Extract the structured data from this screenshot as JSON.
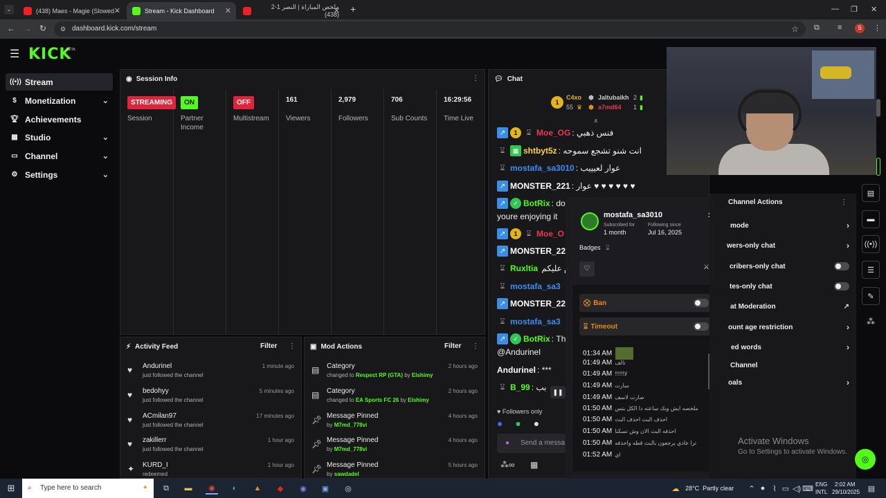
{
  "browser": {
    "tabs": [
      {
        "title": "(438) Maes - Magie (Slowed -"
      },
      {
        "title": "Stream - Kick Dashboard"
      },
      {
        "title": "ملخص المباراة | النصر 1-2 (438)"
      }
    ],
    "url": "dashboard.kick.com/stream",
    "profile_initial": "S"
  },
  "app": {
    "logo": "KICK",
    "logo_tag": "BETA",
    "brand_color": "#53fc18"
  },
  "sidebar": {
    "items": [
      {
        "label": "Stream",
        "icon": "stream-icon"
      },
      {
        "label": "Monetization",
        "icon": "dollar-icon"
      },
      {
        "label": "Achievements",
        "icon": "trophy-icon"
      },
      {
        "label": "Studio",
        "icon": "studio-icon"
      },
      {
        "label": "Channel",
        "icon": "channel-icon"
      },
      {
        "label": "Settings",
        "icon": "gear-icon"
      }
    ]
  },
  "session": {
    "title": "Session Info",
    "stats": [
      {
        "value": "STREAMING",
        "label": "Session"
      },
      {
        "value": "ON",
        "label": "Partner Income"
      },
      {
        "value": "OFF",
        "label": "Multistream"
      },
      {
        "value": "161",
        "label": "Viewers"
      },
      {
        "value": "2,979",
        "label": "Followers"
      },
      {
        "value": "706",
        "label": "Sub Counts"
      },
      {
        "value": "16:29:56",
        "label": "Time Live"
      }
    ]
  },
  "activity": {
    "title": "Activity Feed",
    "filter": "Filter",
    "items": [
      {
        "name": "Andurinel",
        "action": "just followed the channel",
        "time": "1 minute ago"
      },
      {
        "name": "bedohyy",
        "action": "just followed the channel",
        "time": "5 minutes ago"
      },
      {
        "name": "ACmilan97",
        "action": "just followed the channel",
        "time": "17 minutes ago"
      },
      {
        "name": "zakillerr",
        "action": "just followed the channel",
        "time": "1 hour ago"
      },
      {
        "name": "KURD_I",
        "action": "redeemed",
        "time": "1 hour ago"
      }
    ]
  },
  "mod": {
    "title": "Mod Actions",
    "filter": "Filter",
    "items": [
      {
        "title": "Category",
        "pre": "changed to",
        "target": "Respect RP (GTA)",
        "by": "by",
        "user": "Elshimy",
        "time": "2 hours ago"
      },
      {
        "title": "Category",
        "pre": "changed to",
        "target": "EA Sports FC 26",
        "by": "by",
        "user": "Elshimy",
        "time": "2 hours ago"
      },
      {
        "title": "Message Pinned",
        "pre": "by",
        "target": "",
        "by": "",
        "user": "M7md_778vi",
        "time": "4 hours ago"
      },
      {
        "title": "Message Pinned",
        "pre": "by",
        "target": "",
        "by": "",
        "user": "M7md_778vi",
        "time": "4 hours ago"
      },
      {
        "title": "Message Pinned",
        "pre": "by",
        "target": "",
        "by": "",
        "user": "sawdadel",
        "time": "5 hours ago"
      }
    ]
  },
  "chat": {
    "title": "Chat",
    "top_gifters": [
      {
        "name": "C4xo",
        "count": "55"
      },
      {
        "name": "Jaltubaikh",
        "count": "2"
      },
      {
        "name": "a7md64",
        "count": "1"
      }
    ],
    "messages": [
      {
        "user": "Moe_OG",
        "color": "#e8384f",
        "text": "فنس ذهبي"
      },
      {
        "user": "shtbyt5z",
        "color": "#ffd43b",
        "text": "انت شنو تشجع سموحه"
      },
      {
        "user": "mostafa_sa3010",
        "color": "#3d8cf0",
        "text": "عوار لعيييب"
      },
      {
        "user": "MONSTER_221",
        "color": "#ffffff",
        "text": "عوار ♥ ♥ ♥ ♥ ♥ ♥"
      },
      {
        "user": "BotRix",
        "color": "#53fc18",
        "text": "do"
      },
      {
        "user": "",
        "color": "#ffffff",
        "text": "youre enjoying it"
      },
      {
        "user": "Moe_O",
        "color": "#e8384f",
        "text": ""
      },
      {
        "user": "MONSTER_22",
        "color": "#ffffff",
        "text": ""
      },
      {
        "user": "Ruxltia",
        "color": "#53fc18",
        "text": "م عليكم"
      },
      {
        "user": "mostafa_sa3",
        "color": "#3d8cf0",
        "text": ""
      },
      {
        "user": "MONSTER_22",
        "color": "#ffffff",
        "text": ""
      },
      {
        "user": "mostafa_sa3",
        "color": "#3d8cf0",
        "text": ""
      },
      {
        "user": "BotRix",
        "color": "#53fc18",
        "text": "Th"
      },
      {
        "user": "",
        "color": "#ffffff",
        "text": "@Andurinel"
      },
      {
        "user": "Andurinel",
        "color": "#ffffff",
        "text": "***"
      },
      {
        "user": "B_99",
        "color": "#53fc18",
        "text": "بب"
      }
    ],
    "followers_only": "Followers only",
    "send_placeholder": "Send a messa"
  },
  "user_card": {
    "username": "mostafa_sa3010",
    "subscribed_label": "Subscribed for",
    "subscribed_value": "1 month",
    "following_label": "Following since",
    "following_value": "Jul 16, 2025",
    "badges_label": "Badges",
    "ban_label": "Ban",
    "timeout_label": "Timeout",
    "history": [
      {
        "time": "01:34 AM",
        "text": ""
      },
      {
        "time": "01:49 AM",
        "text": "تالف"
      },
      {
        "time": "01:49 AM",
        "text": "!!!!!!لا"
      },
      {
        "time": "01:49 AM",
        "text": "سارت"
      },
      {
        "time": "01:49 AM",
        "text": "صارت لاسف"
      },
      {
        "time": "01:50 AM",
        "text": "ملخصه ايش وبك ساعته دا الكل يتس"
      },
      {
        "time": "01:50 AM",
        "text": "احذف البث احذف البث"
      },
      {
        "time": "01:50 AM",
        "text": "احذفه البث الان وش تسكنا"
      },
      {
        "time": "01:50 AM",
        "text": "ترا عادي يرجعون بالبث قطه واحذفه"
      },
      {
        "time": "01:52 AM",
        "text": "اي"
      }
    ]
  },
  "channel_actions": {
    "title": "Channel Actions",
    "rows": [
      {
        "label": "mode",
        "control": "chevron"
      },
      {
        "label": "wers-only chat",
        "control": "chevron"
      },
      {
        "label": "cribers-only chat",
        "control": "toggle"
      },
      {
        "label": "tes-only chat",
        "control": "toggle"
      },
      {
        "label": "at Moderation",
        "control": "external"
      },
      {
        "label": "ount age restriction",
        "control": "chevron"
      },
      {
        "label": "ed words",
        "control": "chevron"
      },
      {
        "label": "Channel",
        "control": "none"
      },
      {
        "label": "oals",
        "control": "chevron"
      }
    ]
  },
  "watermark": {
    "line1": "Activate Windows",
    "line2": "Go to Settings to activate Windows."
  },
  "taskbar": {
    "search_placeholder": "Type here to search",
    "weather": "28°C  Partly clear",
    "lang1": "ENG",
    "lang2": "INTL",
    "time": "2:02 AM",
    "date": "29/10/2025"
  }
}
